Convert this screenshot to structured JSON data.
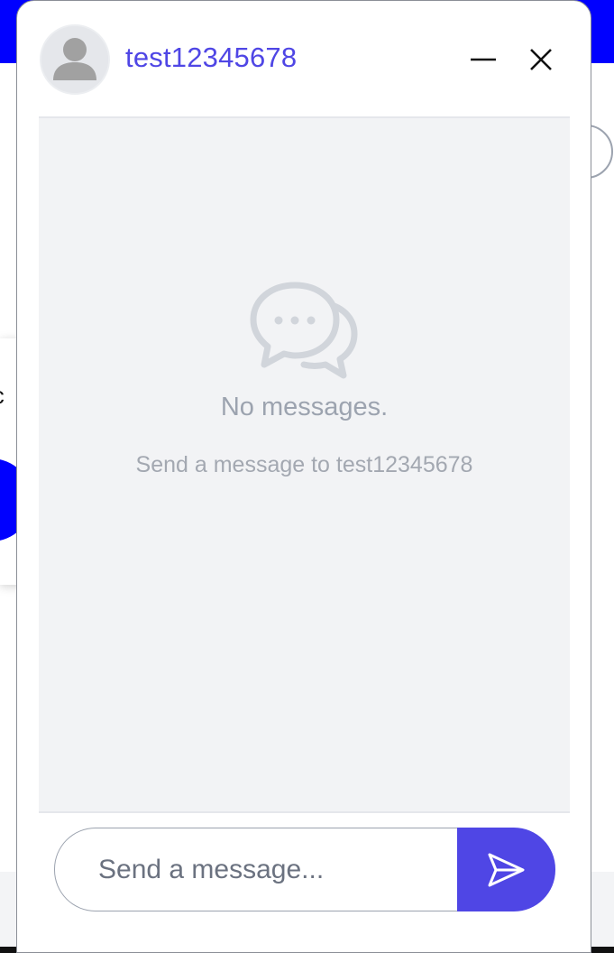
{
  "background": {
    "card_text": "lc"
  },
  "chat": {
    "username": "test12345678",
    "empty_state": {
      "title": "No messages.",
      "subtitle": "Send a message to test12345678",
      "icon": "chat-bubbles-icon"
    },
    "composer": {
      "placeholder": "Send a message...",
      "value": ""
    },
    "icons": {
      "avatar": "user-avatar-icon",
      "minimize": "minimize-icon",
      "close": "close-icon",
      "send": "send-icon"
    }
  },
  "colors": {
    "accent": "#4f46e5",
    "topbar": "#0000ff",
    "messages_bg": "#f2f3f5"
  }
}
